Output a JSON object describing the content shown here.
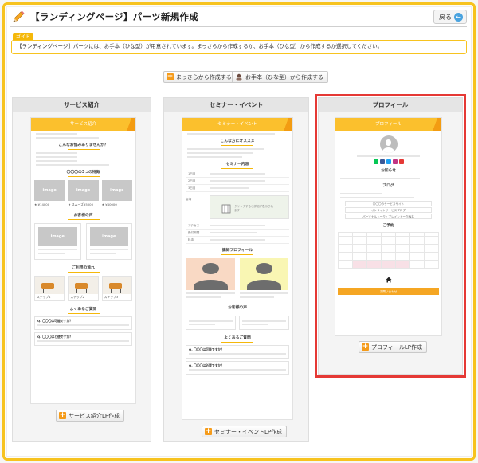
{
  "page": {
    "title": "【ランディングページ】パーツ新規作成",
    "back_label": "戻る",
    "guide_tag": "ガイド",
    "guide_text": "【ランディングページ】パーツには、お手本（ひな型）が用意されています。まっさらから作成するか、お手本（ひな型）から作成するか選択してください。"
  },
  "actions": {
    "blank_label": "まっさらから作成する",
    "template_label": "お手本（ひな型）から作成する"
  },
  "columns": [
    {
      "title": "サービス紹介",
      "button_label": "サービス紹介LP作成",
      "preview": {
        "banner": "サービス紹介",
        "sec_worries": "こんなお悩みありませんか？",
        "sec_features": "〇〇〇の3つの特徴",
        "image_label": "image",
        "prices": [
          "★ ¥14000",
          "★ スムーズ¥5000",
          "★ ¥40000"
        ],
        "sec_voice": "お客様の声",
        "sec_flow": "ご利用の流れ",
        "steps": [
          "ステップ1",
          "ステップ2",
          "ステップ3"
        ],
        "sec_faq": "よくあるご質問",
        "faq_q1": "Q. 〇〇〇は可能ですか？",
        "faq_q2": "Q. 〇〇〇はど使ですか？"
      }
    },
    {
      "title": "セミナー・イベント",
      "button_label": "セミナー・イベントLP作成",
      "preview": {
        "banner": "セミナー・イベント",
        "sec_recommend": "こんな方にオススメ",
        "sec_content": "セミナー内容",
        "map_text": "クリックすると詳細が表示されます",
        "sec_profile": "講師プロフィール",
        "sec_voice": "お客様の声",
        "sec_faq": "よくあるご質問",
        "faq_q1": "Q. 〇〇〇は可能ですか？",
        "faq_q2": "Q. 〇〇〇は必要ですか？"
      }
    },
    {
      "title": "プロフィール",
      "button_label": "プロフィールLP作成",
      "preview": {
        "banner": "プロフィール",
        "sec_news": "お知らせ",
        "sec_blog": "ブログ",
        "blog_links": [
          "〇〇〇のサービスサイト",
          "オンラインサービスブログ",
          "パーソナルトーク・ブレイントークIN名"
        ],
        "sec_schedule": "ご予約",
        "cta": "お問い合わせ"
      }
    }
  ],
  "colors": {
    "accent": "#f7c31f",
    "banner": "#fbc02d",
    "plus": "#f59b1a",
    "highlight": "#e53935"
  }
}
